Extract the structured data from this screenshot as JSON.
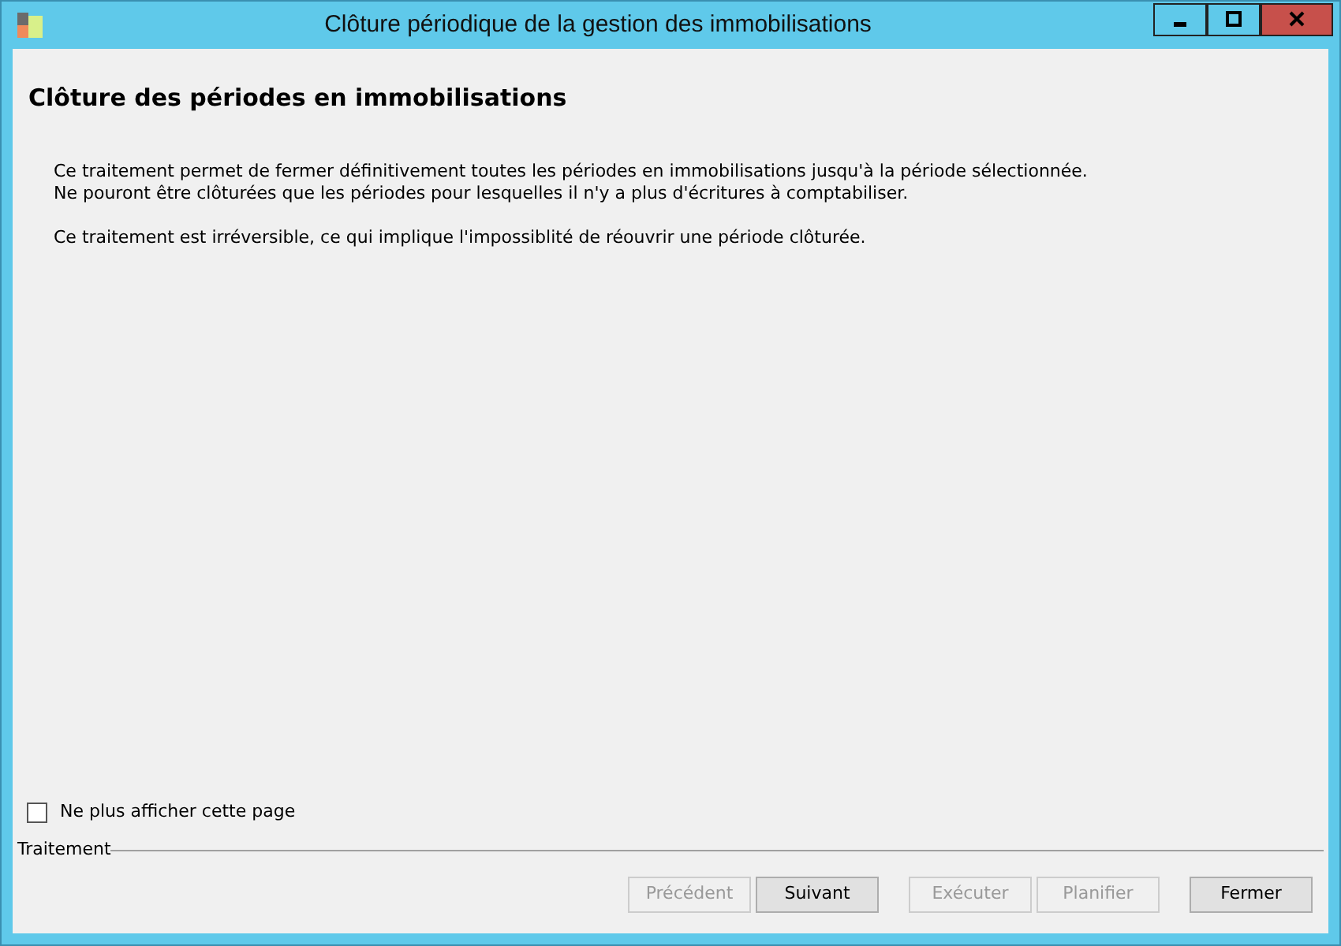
{
  "window": {
    "title": "Clôture périodique de la gestion des immobilisations"
  },
  "heading": "Clôture des périodes en immobilisations",
  "paragraphs": [
    "Ce traitement permet de fermer définitivement toutes les périodes en  immobilisations jusqu'à la période sélectionnée.\nNe pouront être clôturées que les périodes pour lesquelles il n'y a plus d'écritures à comptabiliser.",
    "Ce traitement est irréversible, ce qui implique l'impossiblité de réouvrir une période clôturée."
  ],
  "dont_show": {
    "label": "Ne plus afficher cette page",
    "checked": false
  },
  "group_label": "Traitement",
  "button_groups": [
    [
      {
        "label": "Précédent",
        "disabled": true
      },
      {
        "label": "Suivant",
        "disabled": false
      }
    ],
    [
      {
        "label": "Exécuter",
        "disabled": true
      },
      {
        "label": "Planifier",
        "disabled": true
      }
    ],
    [
      {
        "label": "Fermer",
        "disabled": false
      }
    ]
  ]
}
